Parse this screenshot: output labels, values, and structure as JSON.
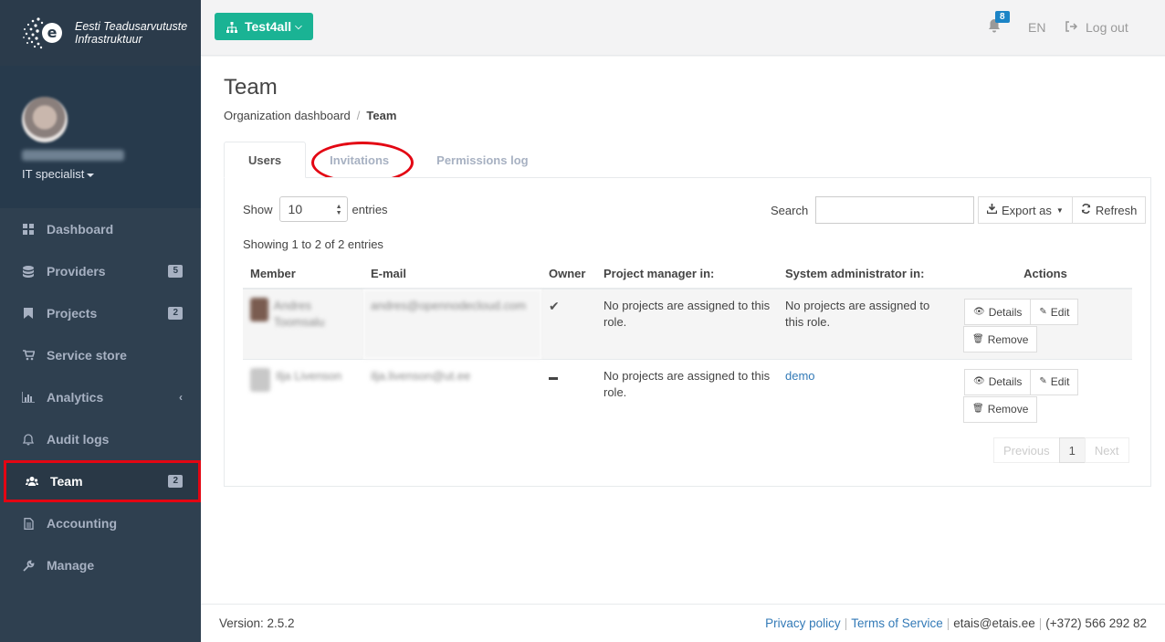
{
  "brand": {
    "line1": "Eesti Teadusarvutuste",
    "line2": "Infrastruktuur",
    "logo_letter": "e"
  },
  "profile": {
    "role": "IT specialist"
  },
  "nav": [
    {
      "label": "Dashboard",
      "icon": "grid-icon"
    },
    {
      "label": "Providers",
      "icon": "database-icon",
      "badge": "5"
    },
    {
      "label": "Projects",
      "icon": "bookmark-icon",
      "badge": "2"
    },
    {
      "label": "Service store",
      "icon": "cart-icon"
    },
    {
      "label": "Analytics",
      "icon": "bar-chart-icon"
    },
    {
      "label": "Audit logs",
      "icon": "bell-icon"
    },
    {
      "label": "Team",
      "icon": "users-icon",
      "badge": "2"
    },
    {
      "label": "Accounting",
      "icon": "file-icon"
    },
    {
      "label": "Manage",
      "icon": "wrench-icon"
    }
  ],
  "topbar": {
    "org": "Test4all",
    "notifications": "8",
    "lang": "EN",
    "logout": "Log out"
  },
  "page": {
    "title": "Team",
    "breadcrumb": {
      "parent": "Organization dashboard",
      "current": "Team"
    },
    "tabs": [
      "Users",
      "Invitations",
      "Permissions log"
    ]
  },
  "table_controls": {
    "show": "Show",
    "entries_value": "10",
    "entries": "entries",
    "search": "Search",
    "export": "Export as",
    "refresh": "Refresh",
    "showing": "Showing 1 to 2 of 2 entries"
  },
  "columns": [
    "Member",
    "E-mail",
    "Owner",
    "Project manager in:",
    "System administrator in:",
    "Actions"
  ],
  "rows": [
    {
      "member": "Andres Toomsalu",
      "email": "andres@opennodecloud.com",
      "owner": "yes",
      "pm": "No projects are assigned to this role.",
      "sysadmin": "No projects are assigned to this role."
    },
    {
      "member": "Ilja Livenson",
      "email": "ilja.livenson@ut.ee",
      "owner": "no",
      "pm": "No projects are assigned to this role.",
      "sysadmin": "demo"
    }
  ],
  "row_actions": {
    "details": "Details",
    "edit": "Edit",
    "remove": "Remove"
  },
  "pagination": {
    "previous": "Previous",
    "page": "1",
    "next": "Next"
  },
  "footer": {
    "version": "Version: 2.5.2",
    "privacy": "Privacy policy",
    "terms": "Terms of Service",
    "email": "etais@etais.ee",
    "phone": "(+372) 566 292 82"
  },
  "colors": {
    "sidebar": "#2f4050",
    "accent": "#1ab394",
    "highlight": "#e30613",
    "link": "#337ab7"
  }
}
